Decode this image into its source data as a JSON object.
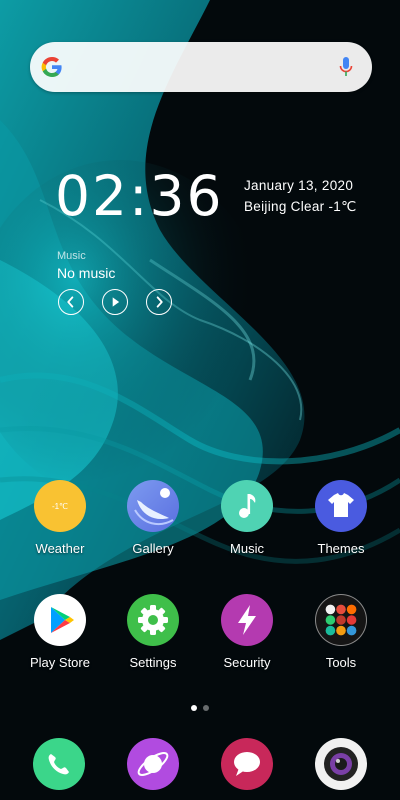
{
  "search": {
    "logo_icon": "google-g-icon",
    "mic_icon": "microphone-icon"
  },
  "clock": {
    "time": "02:36",
    "date": "January 13, 2020",
    "weather": "Beijing  Clear  -1℃"
  },
  "music": {
    "label": "Music",
    "track": "No music"
  },
  "apps": [
    {
      "label": "Weather",
      "badge": "-1℃",
      "color": "#f9c232"
    },
    {
      "label": "Gallery",
      "color": "#6e86e8"
    },
    {
      "label": "Music",
      "color": "#4fd3b3"
    },
    {
      "label": "Themes",
      "color": "#4a5be0"
    },
    {
      "label": "Play Store",
      "color": "#ffffff"
    },
    {
      "label": "Settings",
      "color": "#3fbf4a"
    },
    {
      "label": "Security",
      "color": "#b43ab0"
    },
    {
      "label": "Tools",
      "color": "#151515"
    }
  ],
  "pager": {
    "total": 2,
    "active": 1
  },
  "dock": [
    {
      "name": "phone",
      "color": "#3bd68a"
    },
    {
      "name": "browser",
      "color": "#b14be0"
    },
    {
      "name": "messages",
      "color": "#c8285a"
    },
    {
      "name": "camera",
      "color": "#f1f1f1"
    }
  ]
}
